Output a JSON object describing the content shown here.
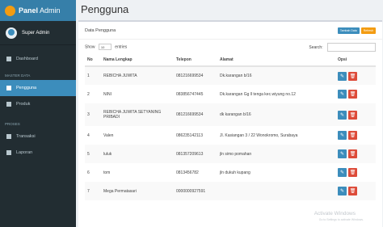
{
  "brand": {
    "strong": "Panel",
    "light": "Admin"
  },
  "user": {
    "name": "Super Admin"
  },
  "sidebar": {
    "dashboard": "Dashboard",
    "section_master": "MASTER DATA",
    "pengguna": "Pengguna",
    "produk": "Produk",
    "section_proses": "PROSES",
    "transaksi": "Transaksi",
    "laporan": "Laporan"
  },
  "page": {
    "title": "Pengguna"
  },
  "box": {
    "title": "Data Pengguna",
    "btn_add": "Tambah Data",
    "btn_refresh": "Refresh"
  },
  "controls": {
    "show": "Show",
    "entries_value": "10",
    "entries": "entries",
    "search": "Search:"
  },
  "table": {
    "headers": [
      "No",
      "Nama Lengkap",
      "Telepon",
      "Alamat",
      "Opsi"
    ],
    "rows": [
      {
        "no": "1",
        "nama": "REBICHA JUWITA",
        "telp": "081216699534",
        "alamat": "Dk.karangan b/16"
      },
      {
        "no": "2",
        "nama": "NINI",
        "telp": "083856747445",
        "alamat": "Dk.karangan Gg ll tenga kec.wiyung no.12"
      },
      {
        "no": "3",
        "nama": "REBICHA JUWITA SETYANING PRIBADI",
        "telp": "081216699534",
        "alamat": "dk karangan b/16"
      },
      {
        "no": "4",
        "nama": "Valen",
        "telp": "086235142113",
        "alamat": "Jl. Kasiangan 3 / 22 Wonokromo, Surabaya"
      },
      {
        "no": "5",
        "nama": "luluk",
        "telp": "081357209613",
        "alamat": "jln simo pomahan"
      },
      {
        "no": "6",
        "nama": "tom",
        "telp": "0813456782",
        "alamat": "jln dukuh kupang"
      },
      {
        "no": "7",
        "nama": "Mega Permatasari",
        "telp": "0000000927591",
        "alamat": ""
      }
    ]
  },
  "watermark": {
    "line1": "Activate Windows",
    "line2": "Go to Settings to activate Windows."
  },
  "colors": {
    "sidebar": "#222d32",
    "brand": "#367fa9",
    "active": "#3c8dbc",
    "danger": "#dd4b39",
    "warning": "#f39c12"
  }
}
